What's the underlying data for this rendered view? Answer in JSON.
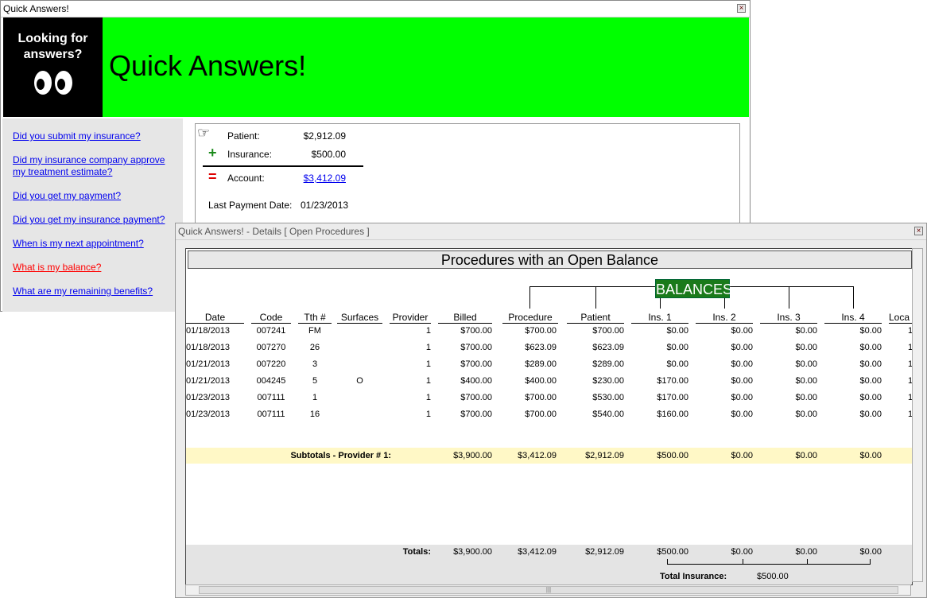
{
  "main_window": {
    "title": "Quick Answers!",
    "logo_text": "Looking for answers?",
    "banner_title": "Quick Answers!",
    "links": [
      "Did you submit my insurance?",
      "Did my insurance company approve my treatment estimate?",
      "Did you get my payment?",
      "Did you get my insurance payment?",
      "When is my next appointment?",
      "What is my balance?",
      "What are my remaining benefits?"
    ],
    "summary": {
      "patient_label": "Patient:",
      "patient_value": "$2,912.09",
      "insurance_label": "Insurance:",
      "insurance_value": "$500.00",
      "account_label": "Account:",
      "account_value": "$3,412.09",
      "plus_symbol": "+",
      "equals_symbol": "=",
      "last_payment_label": "Last Payment Date:",
      "last_payment_value": "01/23/2013"
    }
  },
  "details_window": {
    "title": "Quick Answers! - Details [ Open Procedures ]",
    "report_title": "Procedures with an Open Balance",
    "balances_label": "BALANCES",
    "columns": [
      "Date",
      "Code",
      "Tth #",
      "Surfaces",
      "Provider",
      "Billed",
      "Procedure",
      "Patient",
      "Ins. 1",
      "Ins. 2",
      "Ins. 3",
      "Ins. 4",
      "Loca"
    ],
    "rows": [
      [
        "01/18/2013",
        "007241",
        "FM",
        "",
        "1",
        "$700.00",
        "$700.00",
        "$700.00",
        "$0.00",
        "$0.00",
        "$0.00",
        "$0.00",
        "1"
      ],
      [
        "01/18/2013",
        "007270",
        "26",
        "",
        "1",
        "$700.00",
        "$623.09",
        "$623.09",
        "$0.00",
        "$0.00",
        "$0.00",
        "$0.00",
        "1"
      ],
      [
        "01/21/2013",
        "007220",
        "3",
        "",
        "1",
        "$700.00",
        "$289.00",
        "$289.00",
        "$0.00",
        "$0.00",
        "$0.00",
        "$0.00",
        "1"
      ],
      [
        "01/21/2013",
        "004245",
        "5",
        "O",
        "1",
        "$400.00",
        "$400.00",
        "$230.00",
        "$170.00",
        "$0.00",
        "$0.00",
        "$0.00",
        "1"
      ],
      [
        "01/23/2013",
        "007111",
        "1",
        "",
        "1",
        "$700.00",
        "$700.00",
        "$530.00",
        "$170.00",
        "$0.00",
        "$0.00",
        "$0.00",
        "1"
      ],
      [
        "01/23/2013",
        "007111",
        "16",
        "",
        "1",
        "$700.00",
        "$700.00",
        "$540.00",
        "$160.00",
        "$0.00",
        "$0.00",
        "$0.00",
        "1"
      ]
    ],
    "subtotal": {
      "label": "Subtotals - Provider # 1:",
      "values": [
        "$3,900.00",
        "$3,412.09",
        "$2,912.09",
        "$500.00",
        "$0.00",
        "$0.00",
        "$0.00"
      ]
    },
    "totals": {
      "label": "Totals:",
      "values": [
        "$3,900.00",
        "$3,412.09",
        "$2,912.09",
        "$500.00",
        "$0.00",
        "$0.00",
        "$0.00"
      ],
      "total_insurance_label": "Total Insurance:",
      "total_insurance_value": "$500.00"
    }
  },
  "colors": {
    "banner_green": "#00ff00",
    "balances_green": "#1a7a1a",
    "link_blue": "#0000ee",
    "active_link_red": "#ff0000",
    "subtotal_yellow": "#fff8c6"
  },
  "icons": [
    "pointing-hand-icon",
    "plus-icon",
    "equals-icon",
    "close-icon",
    "eyes-icon"
  ]
}
